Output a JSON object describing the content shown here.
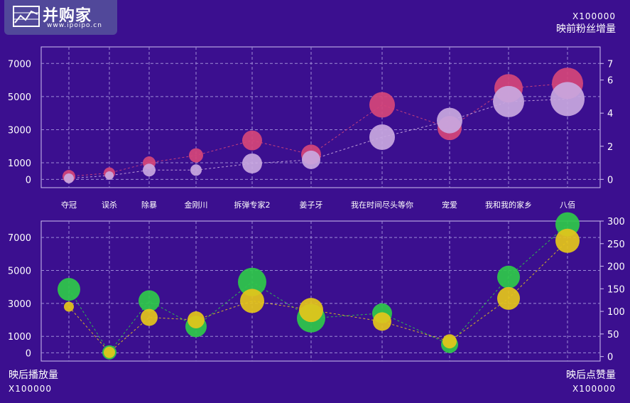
{
  "logo": {
    "name": "并购家",
    "url": "www.ipoipo.cn"
  },
  "top_right": {
    "unit": "X100000",
    "title": "映前粉丝增量"
  },
  "bottom_left": {
    "title": "映后播放量",
    "unit": "X100000"
  },
  "bottom_right": {
    "title": "映后点赞量",
    "unit": "X100000"
  },
  "colors": {
    "background": "#3b0f8f",
    "pink": "#d6457a",
    "lavender": "#c9a8e0",
    "green": "#2fc94a",
    "yellow": "#e5c51a"
  },
  "chart_data": [
    {
      "type": "scatter",
      "categories": [
        "夺冠",
        "误杀",
        "除暴",
        "金刚川",
        "拆弹专家2",
        "姜子牙",
        "我在时间尽头等你",
        "宠爱",
        "我和我的家乡",
        "八佰"
      ],
      "y_left_ticks": [
        0,
        1000,
        3000,
        5000,
        7000
      ],
      "y_right_ticks": [
        0,
        2,
        4,
        6,
        7
      ],
      "ylim_left": [
        -500,
        8000
      ],
      "ylim_right": [
        -0.5,
        8
      ],
      "grid": true,
      "series": [
        {
          "color": "#d6457a",
          "values": [
            180,
            380,
            1000,
            1450,
            2350,
            1500,
            4500,
            3100,
            5500,
            5800
          ]
        },
        {
          "color": "#c9a8e0",
          "values": [
            60,
            230,
            560,
            560,
            960,
            1180,
            2550,
            3550,
            4700,
            4850
          ]
        }
      ]
    },
    {
      "type": "scatter",
      "categories": [
        "夺冠",
        "误杀",
        "除暴",
        "金刚川",
        "拆弹专家2",
        "姜子牙",
        "我在时间尽头等你",
        "宠爱",
        "我和我的家乡",
        "八佰"
      ],
      "y_left_ticks": [
        0,
        1000,
        3000,
        5000,
        7000
      ],
      "y_right_ticks": [
        0,
        50,
        100,
        150,
        200,
        250,
        300
      ],
      "ylim_left": [
        -500,
        8000
      ],
      "ylim_right": [
        -10,
        300
      ],
      "grid": true,
      "series": [
        {
          "color": "#2fc94a",
          "values": [
            3850,
            30,
            3150,
            1600,
            4300,
            2100,
            2400,
            500,
            4600,
            7800
          ]
        },
        {
          "color": "#e5c51a",
          "values": [
            2800,
            30,
            2150,
            2000,
            3150,
            2600,
            1900,
            700,
            3300,
            6800
          ]
        }
      ]
    }
  ]
}
